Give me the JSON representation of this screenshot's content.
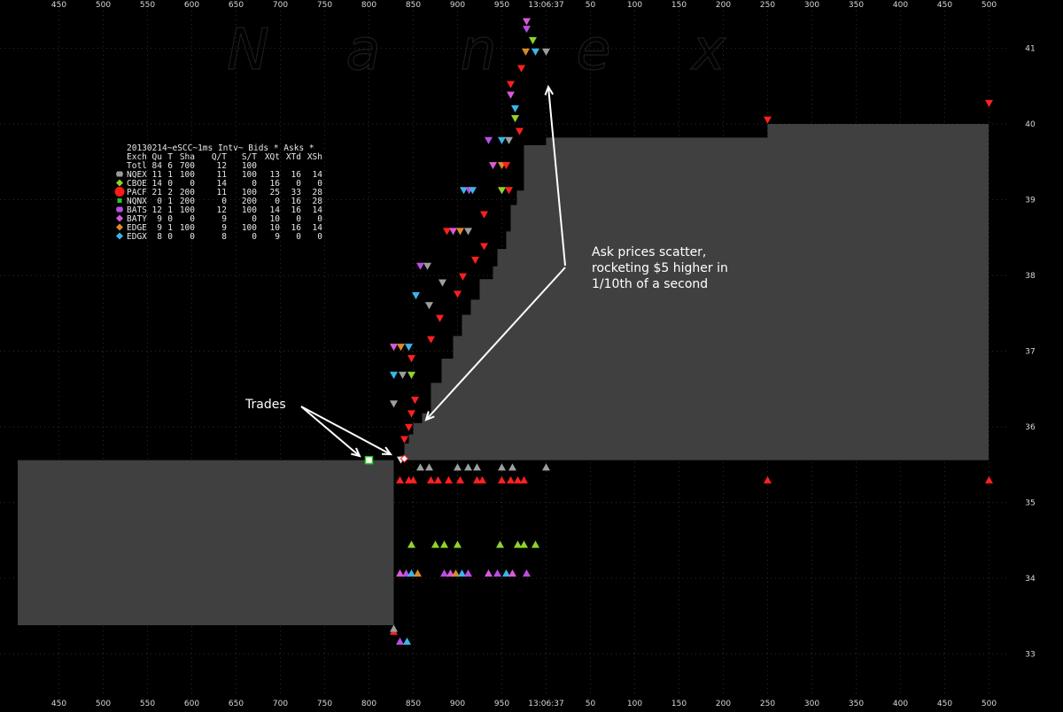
{
  "watermark": {
    "letters": [
      "N",
      "a",
      "n",
      "e",
      "x"
    ]
  },
  "chart_data": {
    "type": "scatter",
    "title": "",
    "time_label": "13:06:37",
    "x_ticks_ms": [
      "450",
      "500",
      "550",
      "600",
      "650",
      "700",
      "750",
      "800",
      "850",
      "900",
      "950",
      "13:06:37",
      "50",
      "100",
      "150",
      "200",
      "250",
      "300",
      "350",
      "400",
      "450",
      "500"
    ],
    "y_ticks": [
      33,
      34,
      35,
      36,
      37,
      38,
      39,
      40,
      41
    ],
    "ylim": [
      32.6,
      41.5
    ],
    "legend_header": "20130214~eSCC~1ms Intv~ Bids * Asks *",
    "legend_columns": [
      "Exch",
      "Qu",
      "T",
      "Sha",
      "Q/T",
      "S/T",
      "XQt",
      "XTd",
      "XSh"
    ],
    "legend_total": [
      "Totl",
      "84",
      "6",
      "700",
      "12",
      "100",
      "",
      "",
      ""
    ],
    "legend_rows": [
      {
        "exch": "NQEX",
        "color": "#9a9a9a",
        "values": [
          "11",
          "1",
          "100",
          "11",
          "100",
          "13",
          "16",
          "14"
        ]
      },
      {
        "exch": "CBOE",
        "color": "#8fd42a",
        "values": [
          "14",
          "0",
          "0",
          "14",
          "0",
          "16",
          "0",
          "0"
        ]
      },
      {
        "exch": "PACF",
        "color": "#ff1a1a",
        "values": [
          "21",
          "2",
          "200",
          "11",
          "100",
          "25",
          "33",
          "28"
        ]
      },
      {
        "exch": "NQNX",
        "color": "#22cc22",
        "values": [
          "0",
          "1",
          "200",
          "0",
          "200",
          "0",
          "16",
          "28"
        ]
      },
      {
        "exch": "BATS",
        "color": "#b84fe0",
        "values": [
          "12",
          "1",
          "100",
          "12",
          "100",
          "14",
          "16",
          "14"
        ]
      },
      {
        "exch": "BATY",
        "color": "#d95ad8",
        "values": [
          "9",
          "0",
          "0",
          "9",
          "0",
          "10",
          "0",
          "0"
        ]
      },
      {
        "exch": "EDGE",
        "color": "#d88a2a",
        "values": [
          "9",
          "1",
          "100",
          "9",
          "100",
          "10",
          "16",
          "14"
        ]
      },
      {
        "exch": "EDGX",
        "color": "#3bb5e8",
        "values": [
          "8",
          "0",
          "0",
          "8",
          "0",
          "9",
          "0",
          "0"
        ]
      }
    ],
    "nbbo_before": {
      "bid": 33.38,
      "ask": 35.56
    },
    "nbbo_after_bid": 35.56,
    "ask_steps": [
      {
        "t": 835,
        "ask": 35.62
      },
      {
        "t": 840,
        "ask": 35.78
      },
      {
        "t": 845,
        "ask": 35.9
      },
      {
        "t": 850,
        "ask": 36.05
      },
      {
        "t": 860,
        "ask": 36.18
      },
      {
        "t": 870,
        "ask": 36.58
      },
      {
        "t": 882,
        "ask": 36.9
      },
      {
        "t": 895,
        "ask": 37.2
      },
      {
        "t": 905,
        "ask": 37.48
      },
      {
        "t": 915,
        "ask": 37.68
      },
      {
        "t": 925,
        "ask": 37.95
      },
      {
        "t": 940,
        "ask": 38.12
      },
      {
        "t": 945,
        "ask": 38.35
      },
      {
        "t": 955,
        "ask": 38.58
      },
      {
        "t": 960,
        "ask": 38.93
      },
      {
        "t": 967,
        "ask": 39.12
      },
      {
        "t": 975,
        "ask": 39.72
      },
      {
        "t": 1000,
        "ask": 39.82
      },
      {
        "t": 1250,
        "ask": 40.0
      },
      {
        "t": 1500,
        "ask": 40.0
      }
    ],
    "ask_quotes": [
      {
        "t": 836,
        "p": 35.56,
        "c": "#e0e0e0"
      },
      {
        "t": 840,
        "p": 35.83,
        "c": "#ff2020"
      },
      {
        "t": 845,
        "p": 35.99,
        "c": "#ff2020"
      },
      {
        "t": 848,
        "p": 36.17,
        "c": "#ff2020"
      },
      {
        "t": 828,
        "p": 36.3,
        "c": "#9aa0a0"
      },
      {
        "t": 852,
        "p": 36.35,
        "c": "#ff2020"
      },
      {
        "t": 828,
        "p": 36.68,
        "c": "#3bb5e8"
      },
      {
        "t": 838,
        "p": 36.68,
        "c": "#9aa0a0"
      },
      {
        "t": 848,
        "p": 36.68,
        "c": "#8fd42a"
      },
      {
        "t": 848,
        "p": 36.9,
        "c": "#ff2020"
      },
      {
        "t": 828,
        "p": 37.05,
        "c": "#d95ad8"
      },
      {
        "t": 836,
        "p": 37.05,
        "c": "#d88a2a"
      },
      {
        "t": 845,
        "p": 37.05,
        "c": "#3bb5e8"
      },
      {
        "t": 870,
        "p": 37.15,
        "c": "#ff2020"
      },
      {
        "t": 880,
        "p": 37.43,
        "c": "#ff2020"
      },
      {
        "t": 868,
        "p": 37.6,
        "c": "#9aa0a0"
      },
      {
        "t": 853,
        "p": 37.73,
        "c": "#3bb5e8"
      },
      {
        "t": 900,
        "p": 37.75,
        "c": "#ff2020"
      },
      {
        "t": 883,
        "p": 37.9,
        "c": "#9aa0a0"
      },
      {
        "t": 906,
        "p": 37.98,
        "c": "#ff2020"
      },
      {
        "t": 858,
        "p": 38.12,
        "c": "#b84fe0"
      },
      {
        "t": 866,
        "p": 38.12,
        "c": "#9aa0a0"
      },
      {
        "t": 920,
        "p": 38.2,
        "c": "#ff2020"
      },
      {
        "t": 930,
        "p": 38.38,
        "c": "#ff2020"
      },
      {
        "t": 888,
        "p": 38.58,
        "c": "#ff2020"
      },
      {
        "t": 895,
        "p": 38.58,
        "c": "#d95ad8"
      },
      {
        "t": 903,
        "p": 38.58,
        "c": "#d88a2a"
      },
      {
        "t": 912,
        "p": 38.58,
        "c": "#9aa0a0"
      },
      {
        "t": 930,
        "p": 38.8,
        "c": "#ff2020"
      },
      {
        "t": 907,
        "p": 39.12,
        "c": "#3bb5e8"
      },
      {
        "t": 913,
        "p": 39.12,
        "c": "#b84fe0"
      },
      {
        "t": 917,
        "p": 39.12,
        "c": "#3bb5e8"
      },
      {
        "t": 950,
        "p": 39.12,
        "c": "#8fd42a"
      },
      {
        "t": 958,
        "p": 39.12,
        "c": "#ff2020"
      },
      {
        "t": 940,
        "p": 39.45,
        "c": "#d95ad8"
      },
      {
        "t": 950,
        "p": 39.45,
        "c": "#d88a2a"
      },
      {
        "t": 955,
        "p": 39.45,
        "c": "#ff2020"
      },
      {
        "t": 935,
        "p": 39.78,
        "c": "#b84fe0"
      },
      {
        "t": 950,
        "p": 39.78,
        "c": "#3bb5e8"
      },
      {
        "t": 958,
        "p": 39.78,
        "c": "#9aa0a0"
      },
      {
        "t": 970,
        "p": 39.9,
        "c": "#ff2020"
      },
      {
        "t": 965,
        "p": 40.07,
        "c": "#8fd42a"
      },
      {
        "t": 965,
        "p": 40.2,
        "c": "#3bb5e8"
      },
      {
        "t": 960,
        "p": 40.38,
        "c": "#d95ad8"
      },
      {
        "t": 960,
        "p": 40.52,
        "c": "#ff2020"
      },
      {
        "t": 972,
        "p": 40.73,
        "c": "#ff2020"
      },
      {
        "t": 977,
        "p": 40.95,
        "c": "#d88a2a"
      },
      {
        "t": 988,
        "p": 40.95,
        "c": "#3bb5e8"
      },
      {
        "t": 1000,
        "p": 40.95,
        "c": "#9aa0a0"
      },
      {
        "t": 985,
        "p": 41.1,
        "c": "#8fd42a"
      },
      {
        "t": 978,
        "p": 41.25,
        "c": "#b84fe0"
      },
      {
        "t": 978,
        "p": 41.35,
        "c": "#d95ad8"
      },
      {
        "t": 1250,
        "p": 40.05,
        "c": "#ff2020"
      },
      {
        "t": 1500,
        "p": 40.27,
        "c": "#ff2020"
      }
    ],
    "bid_quotes": [
      {
        "t": 858,
        "p": 35.47,
        "c": "#9aa0a0"
      },
      {
        "t": 868,
        "p": 35.47,
        "c": "#9aa0a0"
      },
      {
        "t": 900,
        "p": 35.47,
        "c": "#9aa0a0"
      },
      {
        "t": 912,
        "p": 35.47,
        "c": "#9aa0a0"
      },
      {
        "t": 922,
        "p": 35.47,
        "c": "#9aa0a0"
      },
      {
        "t": 950,
        "p": 35.47,
        "c": "#9aa0a0"
      },
      {
        "t": 962,
        "p": 35.47,
        "c": "#9aa0a0"
      },
      {
        "t": 1000,
        "p": 35.47,
        "c": "#9aa0a0"
      },
      {
        "t": 835,
        "p": 35.3,
        "c": "#ff2020"
      },
      {
        "t": 845,
        "p": 35.3,
        "c": "#ff2020"
      },
      {
        "t": 850,
        "p": 35.3,
        "c": "#ff2020"
      },
      {
        "t": 870,
        "p": 35.3,
        "c": "#ff2020"
      },
      {
        "t": 878,
        "p": 35.3,
        "c": "#ff2020"
      },
      {
        "t": 890,
        "p": 35.3,
        "c": "#ff2020"
      },
      {
        "t": 903,
        "p": 35.3,
        "c": "#ff2020"
      },
      {
        "t": 922,
        "p": 35.3,
        "c": "#ff2020"
      },
      {
        "t": 928,
        "p": 35.3,
        "c": "#ff2020"
      },
      {
        "t": 950,
        "p": 35.3,
        "c": "#ff2020"
      },
      {
        "t": 960,
        "p": 35.3,
        "c": "#ff2020"
      },
      {
        "t": 968,
        "p": 35.3,
        "c": "#ff2020"
      },
      {
        "t": 975,
        "p": 35.3,
        "c": "#ff2020"
      },
      {
        "t": 1250,
        "p": 35.3,
        "c": "#ff2020"
      },
      {
        "t": 1500,
        "p": 35.3,
        "c": "#ff2020"
      },
      {
        "t": 848,
        "p": 34.45,
        "c": "#8fd42a"
      },
      {
        "t": 875,
        "p": 34.45,
        "c": "#8fd42a"
      },
      {
        "t": 885,
        "p": 34.45,
        "c": "#8fd42a"
      },
      {
        "t": 900,
        "p": 34.45,
        "c": "#8fd42a"
      },
      {
        "t": 948,
        "p": 34.45,
        "c": "#8fd42a"
      },
      {
        "t": 968,
        "p": 34.45,
        "c": "#8fd42a"
      },
      {
        "t": 975,
        "p": 34.45,
        "c": "#8fd42a"
      },
      {
        "t": 988,
        "p": 34.45,
        "c": "#8fd42a"
      },
      {
        "t": 835,
        "p": 34.07,
        "c": "#d95ad8"
      },
      {
        "t": 842,
        "p": 34.07,
        "c": "#b84fe0"
      },
      {
        "t": 848,
        "p": 34.07,
        "c": "#3bb5e8"
      },
      {
        "t": 855,
        "p": 34.07,
        "c": "#d88a2a"
      },
      {
        "t": 885,
        "p": 34.07,
        "c": "#b84fe0"
      },
      {
        "t": 892,
        "p": 34.07,
        "c": "#d95ad8"
      },
      {
        "t": 898,
        "p": 34.07,
        "c": "#d88a2a"
      },
      {
        "t": 905,
        "p": 34.07,
        "c": "#3bb5e8"
      },
      {
        "t": 912,
        "p": 34.07,
        "c": "#b84fe0"
      },
      {
        "t": 935,
        "p": 34.07,
        "c": "#d95ad8"
      },
      {
        "t": 945,
        "p": 34.07,
        "c": "#b84fe0"
      },
      {
        "t": 955,
        "p": 34.07,
        "c": "#3bb5e8"
      },
      {
        "t": 962,
        "p": 34.07,
        "c": "#d95ad8"
      },
      {
        "t": 978,
        "p": 34.07,
        "c": "#b84fe0"
      },
      {
        "t": 828,
        "p": 33.3,
        "c": "#ff2020"
      },
      {
        "t": 828,
        "p": 33.34,
        "c": "#9aa0a0"
      },
      {
        "t": 835,
        "p": 33.17,
        "c": "#b84fe0"
      },
      {
        "t": 843,
        "p": 33.17,
        "c": "#3bb5e8"
      }
    ],
    "trades": [
      {
        "t": 800,
        "p": 35.56,
        "c": "#22cc22"
      },
      {
        "t": 840,
        "p": 35.58,
        "c": "#ff2020"
      }
    ],
    "annotations": [
      {
        "text": "Trades"
      },
      {
        "text": "Ask prices scatter,"
      },
      {
        "text": "rocketing $5 higher in"
      },
      {
        "text": "1/10th of a second"
      }
    ]
  }
}
